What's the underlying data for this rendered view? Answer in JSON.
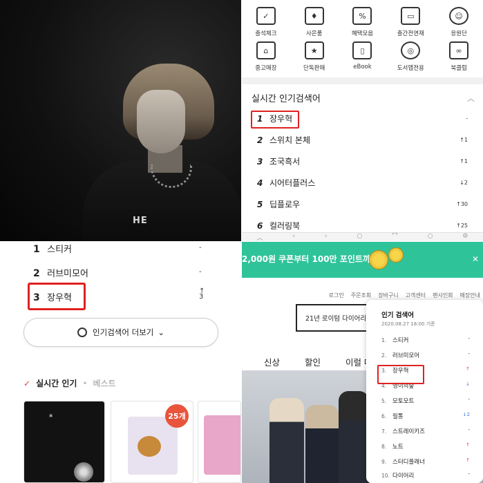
{
  "app": {
    "icons": [
      {
        "label": "출석체크",
        "icon": "calendar-check-icon",
        "glyph": "✓"
      },
      {
        "label": "사은품",
        "icon": "gift-icon",
        "glyph": "♦"
      },
      {
        "label": "혜택모음",
        "icon": "percent-icon",
        "glyph": "%"
      },
      {
        "label": "출간전연재",
        "icon": "book-open-icon",
        "glyph": "▭"
      },
      {
        "label": "응원단",
        "icon": "smile-icon",
        "glyph": "☺"
      },
      {
        "label": "중고매장",
        "icon": "store-icon",
        "glyph": "⌂"
      },
      {
        "label": "단독판매",
        "icon": "star-book-icon",
        "glyph": "★"
      },
      {
        "label": "eBook",
        "icon": "ebook-icon",
        "glyph": "▯"
      },
      {
        "label": "도서앱전용",
        "icon": "ball-icon",
        "glyph": "◎"
      },
      {
        "label": "북클럽",
        "icon": "infinity-icon",
        "glyph": "∞"
      }
    ],
    "realtime_title": "실시간 인기검색어",
    "realtime": [
      {
        "rank": "1",
        "text": "장우혁",
        "change": "-",
        "dir": ""
      },
      {
        "rank": "2",
        "text": "스위치 본체",
        "change": "1",
        "dir": "up"
      },
      {
        "rank": "3",
        "text": "조국흑서",
        "change": "1",
        "dir": "up"
      },
      {
        "rank": "4",
        "text": "시어터플러스",
        "change": "2",
        "dir": "dn"
      },
      {
        "rank": "5",
        "text": "딥플로우",
        "change": "30",
        "dir": "up"
      },
      {
        "rank": "6",
        "text": "컬러링북",
        "change": "25",
        "dir": "up"
      }
    ]
  },
  "web": {
    "rows": [
      {
        "rank": "1",
        "text": "스티커",
        "change": "-"
      },
      {
        "rank": "2",
        "text": "러브미모어",
        "change": "-"
      },
      {
        "rank": "3",
        "text": "장우혁",
        "change": "3"
      }
    ],
    "more_button": "인기검색어 더보기",
    "tab_active": "실시간 인기",
    "tab_inactive": "베스트",
    "badge": "25개"
  },
  "shop": {
    "banner_text": "2,000원 쿠폰부터 100만 포인트까지!",
    "top_links": [
      "로그인",
      "주문조회",
      "장바구니",
      "고객센터",
      "팬사인회",
      "매장안내"
    ],
    "diary_text": "21년 로이텀 다이어리",
    "nav": [
      "신상",
      "할인",
      "이럴 때"
    ],
    "popup_title": "인기 검색어",
    "popup_date": "2020.08.27 18:00 기준",
    "popup_rows": [
      {
        "rank": "1.",
        "text": "스티커",
        "change": "-"
      },
      {
        "rank": "2.",
        "text": "러브미모어",
        "change": "-"
      },
      {
        "rank": "3.",
        "text": "장우혁",
        "change": "↑"
      },
      {
        "rank": "4.",
        "text": "영이의숲",
        "change": "↓"
      },
      {
        "rank": "5.",
        "text": "모토모트",
        "change": "-"
      },
      {
        "rank": "6.",
        "text": "필통",
        "change": "↓2"
      },
      {
        "rank": "7.",
        "text": "스트레이키즈",
        "change": "-"
      },
      {
        "rank": "8.",
        "text": "노트",
        "change": "↑"
      },
      {
        "rank": "9.",
        "text": "스터디플래너",
        "change": "↑"
      },
      {
        "rank": "10.",
        "text": "다이어리",
        "change": "-"
      }
    ]
  },
  "colors": {
    "highlight": "#e02020",
    "banner": "#2fc39a",
    "up": "#e04040",
    "down": "#3a7bd5"
  }
}
